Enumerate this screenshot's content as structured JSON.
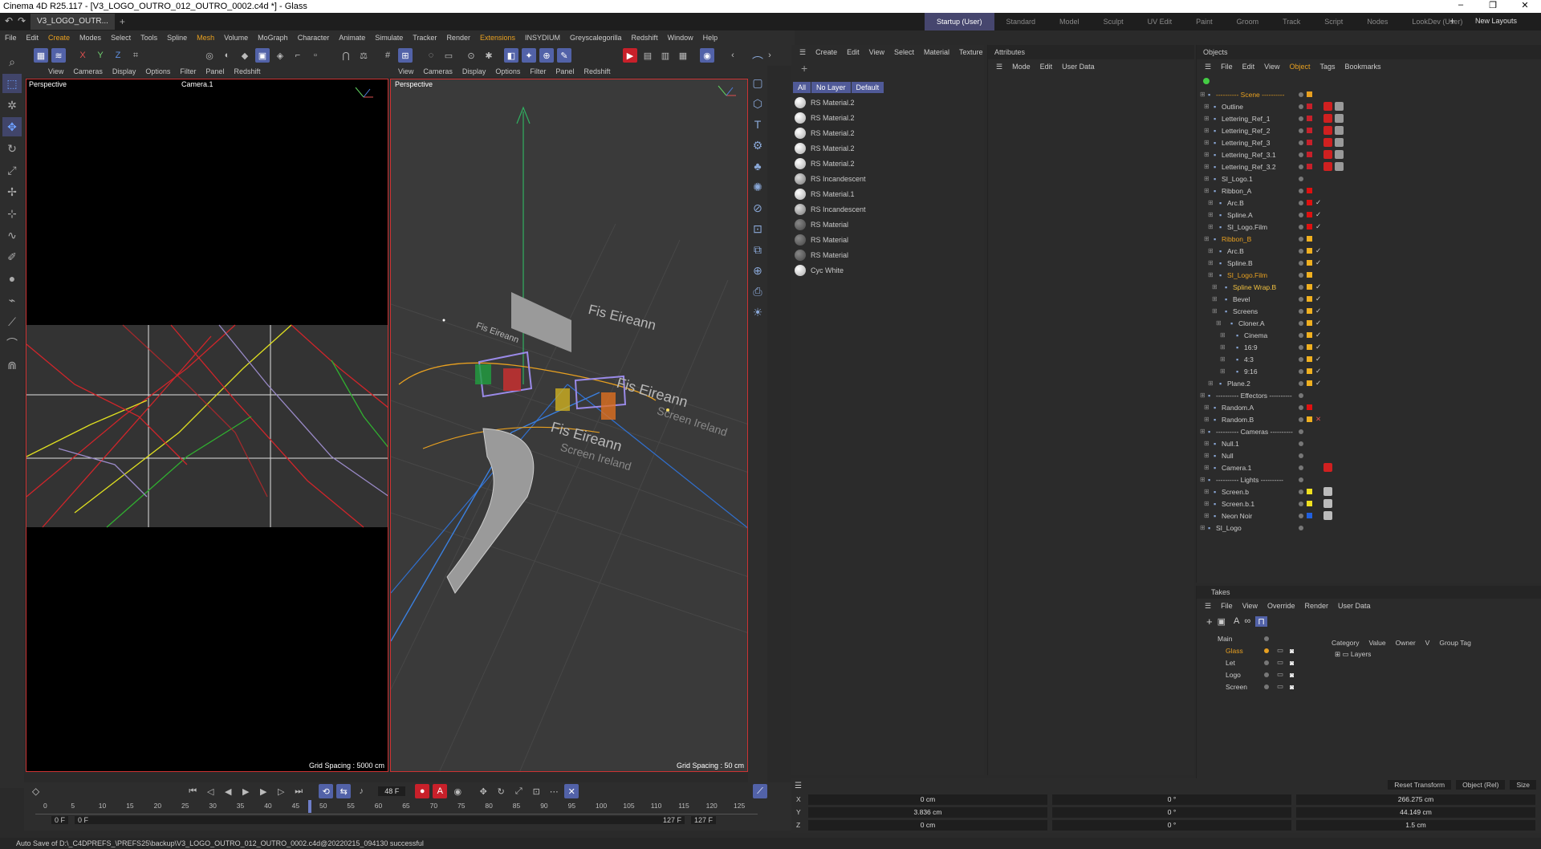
{
  "window": {
    "title": "Cinema 4D R25.117 - [V3_LOGO_OUTRO_012_OUTRO_0002.c4d *] - Glass",
    "controls": [
      "–",
      "❐",
      "✕"
    ]
  },
  "tabs": {
    "document": "V3_LOGO_OUTR...",
    "layouts": [
      "Startup (User)",
      "Standard",
      "Model",
      "Sculpt",
      "UV Edit",
      "Paint",
      "Groom",
      "Track",
      "Script",
      "Nodes",
      "LookDev (User)"
    ],
    "new_layouts": "New Layouts"
  },
  "menu": [
    "File",
    "Edit",
    "Create",
    "Modes",
    "Select",
    "Tools",
    "Spline",
    "Mesh",
    "Volume",
    "MoGraph",
    "Character",
    "Animate",
    "Simulate",
    "Tracker",
    "Render",
    "Extensions",
    "INSYDIUM",
    "Greyscalegorilla",
    "Redshift",
    "Window",
    "Help"
  ],
  "viewport_menu": [
    "View",
    "Cameras",
    "Display",
    "Options",
    "Filter",
    "Panel",
    "Redshift"
  ],
  "viewport_left": {
    "label": "Perspective",
    "camera": "Camera.1",
    "grid": "Grid Spacing : 5000 cm"
  },
  "viewport_right": {
    "label": "Perspective",
    "grid": "Grid Spacing : 50 cm",
    "texts": [
      "Fis Eireann",
      "Fis Eireann",
      "Fis Eireann",
      "Fis Eireann",
      "Screen Ireland",
      "Screen Ireland"
    ]
  },
  "materials": {
    "menu": [
      "Create",
      "Edit",
      "View",
      "Select",
      "Material",
      "Texture"
    ],
    "filters": [
      "All",
      "No Layer",
      "Default"
    ],
    "items": [
      "RS Material.2",
      "RS Material.2",
      "RS Material.2",
      "RS Material.2",
      "RS Material.2",
      "RS Incandescent",
      "RS Material.1",
      "RS Incandescent",
      "RS Material",
      "RS Material",
      "RS Material",
      "Cyc White"
    ]
  },
  "attributes": {
    "title": "Attributes",
    "menu": [
      "Mode",
      "Edit",
      "User Data"
    ]
  },
  "objects": {
    "title": "Objects",
    "menu": [
      "File",
      "Edit",
      "View",
      "Object",
      "Tags",
      "Bookmarks"
    ],
    "items": [
      {
        "name": "---------- Scene ----------",
        "indent": 0,
        "color": "#e8a020",
        "label_color": "#e8a020"
      },
      {
        "name": "Outline",
        "indent": 1,
        "color": "#c8202a"
      },
      {
        "name": "Lettering_Ref_1",
        "indent": 1,
        "color": "#c8202a"
      },
      {
        "name": "Lettering_Ref_2",
        "indent": 1,
        "color": "#c8202a"
      },
      {
        "name": "Lettering_Ref_3",
        "indent": 1,
        "color": "#c8202a"
      },
      {
        "name": "Lettering_Ref_3.1",
        "indent": 1,
        "color": "#c8202a"
      },
      {
        "name": "Lettering_Ref_3.2",
        "indent": 1,
        "color": "#c8202a"
      },
      {
        "name": "SI_Logo.1",
        "indent": 1,
        "color": ""
      },
      {
        "name": "Ribbon_A",
        "indent": 1,
        "color": "#e01010"
      },
      {
        "name": "Arc.B",
        "indent": 2,
        "color": "#e01010"
      },
      {
        "name": "Spline.A",
        "indent": 2,
        "color": "#e01010"
      },
      {
        "name": "SI_Logo.Film",
        "indent": 2,
        "color": "#e01010"
      },
      {
        "name": "Ribbon_B",
        "indent": 1,
        "color": "#f0b020",
        "label_color": "#e8a020"
      },
      {
        "name": "Arc.B",
        "indent": 2,
        "color": "#f0b020"
      },
      {
        "name": "Spline.B",
        "indent": 2,
        "color": "#f0b020"
      },
      {
        "name": "SI_Logo.Film",
        "indent": 2,
        "color": "#f0b020",
        "label_color": "#e8a020"
      },
      {
        "name": "Spline Wrap.B",
        "indent": 3,
        "color": "#f0b020",
        "label_color": "#f0c040"
      },
      {
        "name": "Bevel",
        "indent": 3,
        "color": "#f0b020"
      },
      {
        "name": "Screens",
        "indent": 3,
        "color": "#f0b020"
      },
      {
        "name": "Cloner.A",
        "indent": 4,
        "color": "#f0b020"
      },
      {
        "name": "Cinema",
        "indent": 5,
        "color": "#f0b020"
      },
      {
        "name": "16:9",
        "indent": 5,
        "color": "#f0b020"
      },
      {
        "name": "4:3",
        "indent": 5,
        "color": "#f0b020"
      },
      {
        "name": "9:16",
        "indent": 5,
        "color": "#f0b020"
      },
      {
        "name": "Plane.2",
        "indent": 2,
        "color": "#f0b020"
      },
      {
        "name": "---------- Effectors ----------",
        "indent": 0,
        "color": ""
      },
      {
        "name": "Random.A",
        "indent": 1,
        "color": "#e01010"
      },
      {
        "name": "Random.B",
        "indent": 1,
        "color": "#f0b020"
      },
      {
        "name": "---------- Cameras ----------",
        "indent": 0,
        "color": ""
      },
      {
        "name": "Null.1",
        "indent": 1,
        "color": ""
      },
      {
        "name": "Null",
        "indent": 1,
        "color": ""
      },
      {
        "name": "Camera.1",
        "indent": 1,
        "color": ""
      },
      {
        "name": "---------- Lights ----------",
        "indent": 0,
        "color": ""
      },
      {
        "name": "Screen.b",
        "indent": 1,
        "color": "#f0e020"
      },
      {
        "name": "Screen.b.1",
        "indent": 1,
        "color": "#f0e020"
      },
      {
        "name": "Neon Noir",
        "indent": 1,
        "color": "#2060e0"
      },
      {
        "name": "SI_Logo",
        "indent": 0,
        "color": ""
      }
    ]
  },
  "takes": {
    "title": "Takes",
    "menu": [
      "File",
      "View",
      "Override",
      "Render",
      "User Data"
    ],
    "columns": [
      "Category",
      "Value",
      "Owner",
      "V",
      "Group Tag"
    ],
    "items": [
      {
        "name": "Main",
        "indent": 0
      },
      {
        "name": "Glass",
        "indent": 1,
        "active": true
      },
      {
        "name": "Let",
        "indent": 1
      },
      {
        "name": "Logo",
        "indent": 1
      },
      {
        "name": "Screen",
        "indent": 1
      }
    ],
    "layers": "Layers"
  },
  "timeline": {
    "current_frame": "48 F",
    "start": "0 F",
    "start2": "0 F",
    "end": "127 F",
    "end2": "127 F",
    "ticks": [
      "0",
      "5",
      "10",
      "15",
      "20",
      "25",
      "30",
      "35",
      "40",
      "45",
      "50",
      "55",
      "60",
      "65",
      "70",
      "75",
      "80",
      "85",
      "90",
      "95",
      "100",
      "105",
      "110",
      "115",
      "120",
      "125"
    ],
    "playhead_frame": 48
  },
  "coords": {
    "buttons": [
      "Reset Transform",
      "Object (Rel)",
      "Size"
    ],
    "rows": [
      {
        "axis": "X",
        "pos": "0 cm",
        "rot": "0 °",
        "size": "266.275 cm"
      },
      {
        "axis": "Y",
        "pos": "3.836 cm",
        "rot": "0 °",
        "size": "44.149 cm"
      },
      {
        "axis": "Z",
        "pos": "0 cm",
        "rot": "0 °",
        "size": "1.5 cm"
      }
    ]
  },
  "status": "Auto Save of D:\\_C4DPREFS_\\PREFS25\\backup\\V3_LOGO_OUTRO_012_OUTRO_0002.c4d@20220215_094130 successful"
}
